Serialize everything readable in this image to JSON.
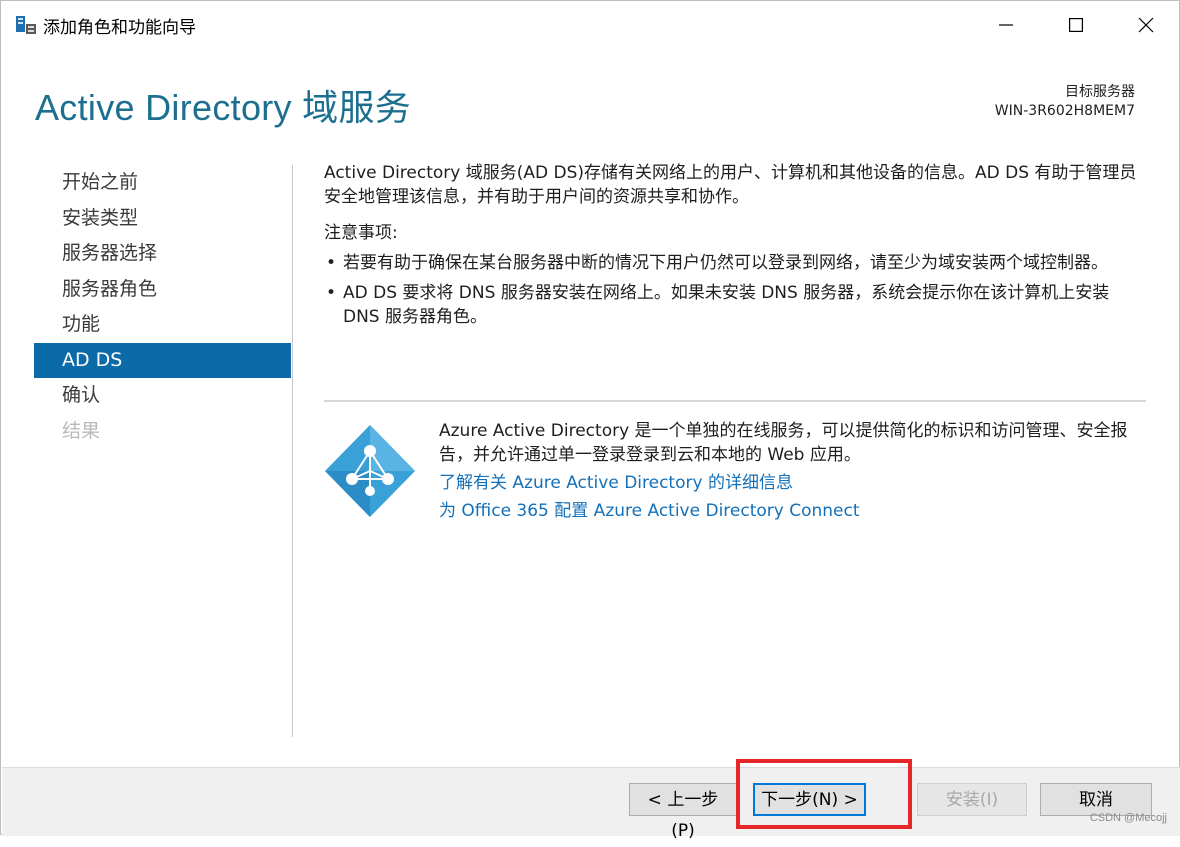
{
  "window": {
    "title": "添加角色和功能向导",
    "controls": {
      "minimize": "minimize-icon",
      "maximize": "maximize-icon",
      "close": "close-icon"
    }
  },
  "header": {
    "title": "Active Directory 域服务",
    "target_label": "目标服务器",
    "target_value": "WIN-3R602H8MEM7"
  },
  "sidebar": {
    "items": [
      {
        "label": "开始之前",
        "state": "normal"
      },
      {
        "label": "安装类型",
        "state": "normal"
      },
      {
        "label": "服务器选择",
        "state": "normal"
      },
      {
        "label": "服务器角色",
        "state": "normal"
      },
      {
        "label": "功能",
        "state": "normal"
      },
      {
        "label": "AD DS",
        "state": "active"
      },
      {
        "label": "确认",
        "state": "normal"
      },
      {
        "label": "结果",
        "state": "disabled"
      }
    ]
  },
  "main": {
    "description": "Active Directory 域服务(AD DS)存储有关网络上的用户、计算机和其他设备的信息。AD DS 有助于管理员安全地管理该信息，并有助于用户间的资源共享和协作。",
    "notes_heading": "注意事项:",
    "notes": [
      "若要有助于确保在某台服务器中断的情况下用户仍然可以登录到网络，请至少为域安装两个域控制器。",
      "AD DS 要求将 DNS 服务器安装在网络上。如果未安装 DNS 服务器，系统会提示你在该计算机上安装 DNS 服务器角色。"
    ],
    "azure": {
      "text": "Azure Active Directory 是一个单独的在线服务，可以提供简化的标识和访问管理、安全报告，并允许通过单一登录登录到云和本地的 Web 应用。",
      "link1": "了解有关 Azure Active Directory 的详细信息",
      "link2": "为 Office 365 配置 Azure Active Directory Connect",
      "icon": "azure-ad-icon"
    }
  },
  "footer": {
    "prev": "< 上一步(P)",
    "next": "下一步(N) >",
    "install": "安装(I)",
    "cancel": "取消"
  },
  "watermark": "CSDN @Mecojj",
  "colors": {
    "accent": "#1d6f90",
    "nav_active": "#0b6aa8",
    "link": "#1470b8",
    "highlight": "#e5262b",
    "azure": "#3aa0d8"
  }
}
